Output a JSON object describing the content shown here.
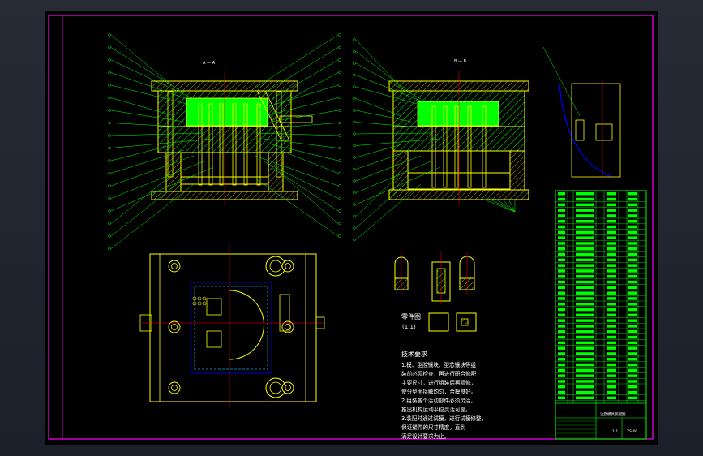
{
  "drawing": {
    "section_a_label": "A — A",
    "section_b_label": "B — B",
    "plan_view_label": "",
    "scale_note": "(1:1)",
    "part_label": "零件图",
    "tech_requirements_title": "技术要求",
    "tech_requirements": [
      "1.模、型腔镶块、型芯镶块等组",
      "  装前必须检查，再进行研合修配",
      "  主要尺寸，进行组装后再精修，",
      "  使分型面接触均匀，合模良好。",
      "2.组装各个活动部件必须灵活，",
      "  推出机构运动平稳灵活可靠。",
      "3.装配时通过试模，进行试模修整，",
      "  保证塑件的尺寸精度，直到",
      "  满足设计要求为止。"
    ],
    "title_block": {
      "name": "注塑模具装配图",
      "drawing_no": "ZS-00",
      "scale": "1:1"
    }
  },
  "colors": {
    "background": "#000000",
    "frame": "#ff00ff",
    "leaders": "#00ff00",
    "mold_plates": "#ffff00",
    "cavity_fill": "#00ff00",
    "hatch": "#00ff00",
    "holes": "#ffff00",
    "centerlines": "#ff0000",
    "detail_outline": "#0000ff",
    "table_lines": "#00ff00",
    "text": "#ffffff"
  }
}
